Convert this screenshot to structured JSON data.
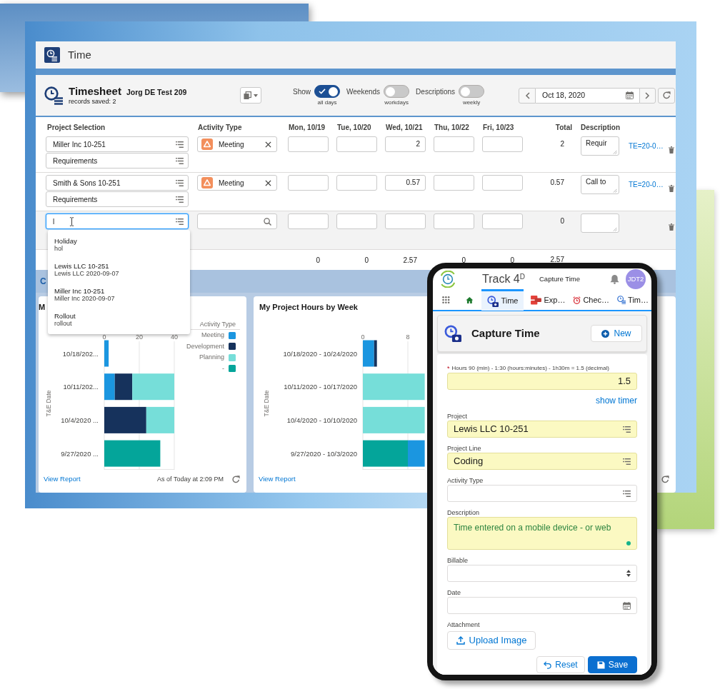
{
  "app": {
    "title": "Time"
  },
  "timesheet": {
    "title": "Timesheet",
    "subtitle": "Jorg DE Test 209",
    "records_saved": "records saved: 2",
    "toggles": [
      {
        "label": "Show",
        "caption": "all days",
        "on": true
      },
      {
        "label": "Weekends",
        "caption": "workdays",
        "on": false
      },
      {
        "label": "Descriptions",
        "caption": "weekly",
        "on": false
      }
    ],
    "date": "Oct 18, 2020"
  },
  "table": {
    "columns": [
      "Project Selection",
      "Activity Type",
      "Mon, 10/19",
      "Tue, 10/20",
      "Wed, 10/21",
      "Thu, 10/22",
      "Fri, 10/23",
      "Total",
      "Description"
    ],
    "rows": [
      {
        "selected": false,
        "project": {
          "value": "Miller Inc 10-251",
          "focused": false
        },
        "project_line": "Requirements",
        "activity": "Meeting",
        "hours": {
          "wed": "2"
        },
        "total": "2",
        "description": "Requir",
        "link": "TE=20-0…"
      },
      {
        "selected": false,
        "project": {
          "value": "Smith & Sons 10-251",
          "focused": false
        },
        "project_line": "Requirements",
        "activity": "Meeting",
        "hours": {
          "wed": "0.57"
        },
        "total": "0.57",
        "description": "Call to",
        "link": "TE=20-0…"
      },
      {
        "selected": true,
        "project": {
          "value": "l",
          "focused": true
        },
        "total": "0"
      }
    ],
    "totals": {
      "days": [
        "0",
        "0",
        "2.57",
        "0",
        "0"
      ],
      "total": "2.57"
    }
  },
  "project_dropdown": {
    "options": [
      {
        "title": "Holiday",
        "subtitle": "hol"
      },
      {
        "title": "Lewis LLC 10-251",
        "subtitle": "Lewis LLC 2020-09-07"
      },
      {
        "title": "Miller Inc 10-251",
        "subtitle": "Miller Inc 2020-09-07"
      },
      {
        "title": "Rollout",
        "subtitle": "rollout"
      }
    ]
  },
  "dashboard": {
    "heading": "C",
    "charts": [
      {
        "legend_title": "Activity Type",
        "footer_link": "View Report",
        "timestamp": "As of Today at 2:09 PM",
        "chart_data": {
          "type": "bar",
          "orientation": "horizontal",
          "stacked": true,
          "title": "M",
          "ylabel": "T&E Date",
          "categories": [
            "10/18/202...",
            "10/11/202...",
            "10/4/2020 ...",
            "9/27/2020 ..."
          ],
          "xlim": [
            0,
            40
          ],
          "xticks": [
            0,
            20,
            40
          ],
          "series": [
            {
              "name": "Meeting",
              "color": "#1b96e0",
              "values": [
                2.5,
                6,
                0,
                0
              ]
            },
            {
              "name": "Development",
              "color": "#16325c",
              "values": [
                0,
                10,
                24,
                0
              ]
            },
            {
              "name": "Planning",
              "color": "#76ded9",
              "values": [
                0,
                24,
                16,
                0
              ]
            },
            {
              "name": "-",
              "color": "#04a59a",
              "values": [
                0,
                0,
                0,
                32
              ]
            }
          ]
        }
      },
      {
        "footer_link": "View Report",
        "chart_data": {
          "type": "bar",
          "orientation": "horizontal",
          "stacked": true,
          "title": "My Project Hours by Week",
          "ylabel": "T&E Date",
          "categories": [
            "10/18/2020 - 10/24/2020",
            "10/11/2020 - 10/17/2020",
            "10/4/2020 - 10/10/2020",
            "9/27/2020 - 10/3/2020"
          ],
          "xlim": [
            0,
            11
          ],
          "xticks": [
            0,
            8
          ],
          "series": [
            {
              "color": "#04a59a",
              "values": [
                0,
                0,
                0,
                8
              ]
            },
            {
              "color": "#1b96e0",
              "values": [
                2,
                0,
                0,
                3
              ]
            },
            {
              "color": "#16325c",
              "values": [
                0.5,
                0,
                0,
                0
              ]
            },
            {
              "color": "#76ded9",
              "values": [
                0,
                11,
                11,
                0
              ]
            }
          ]
        }
      }
    ]
  },
  "mobile": {
    "app_name": "Track 4$^{D}$",
    "page_title": "Capture Time",
    "avatar": "JDT2",
    "tabs": [
      {
        "kind": "time",
        "label": "Time",
        "selected": true
      },
      {
        "kind": "expense",
        "label": "Exp…",
        "selected": false
      },
      {
        "kind": "alarm",
        "label": "Chec…",
        "selected": false
      },
      {
        "kind": "timesheet",
        "label": "Tim…",
        "selected": false
      }
    ],
    "header": {
      "title": "Capture Time",
      "button": "New"
    },
    "fields": [
      {
        "kind": "number",
        "required_mark": "*",
        "label": "Hours 90 (min) - 1:30 (hours:minutes) - 1h30m = 1.5 (decimal)",
        "value": "1.5",
        "highlighted": true
      },
      {
        "kind": "link",
        "text": "show timer"
      },
      {
        "kind": "lookup",
        "label": "Project",
        "value": "Lewis LLC 10-251",
        "highlighted": true
      },
      {
        "kind": "lookup",
        "label": "Project Line",
        "value": "Coding",
        "highlighted": true
      },
      {
        "kind": "lookup",
        "label": "Activity Type",
        "highlighted": false
      },
      {
        "kind": "textarea",
        "label": "Description",
        "value": "Time entered on a mobile device - or web",
        "highlighted": true
      },
      {
        "kind": "select",
        "label": "Billable",
        "highlighted": false
      },
      {
        "kind": "date",
        "label": "Date",
        "highlighted": false
      },
      {
        "kind": "upload",
        "label": "Attachment",
        "button": "Upload Image"
      }
    ],
    "actions": [
      {
        "kind": "neutral",
        "label": "Reset"
      },
      {
        "kind": "brand",
        "label": "Save"
      }
    ]
  }
}
